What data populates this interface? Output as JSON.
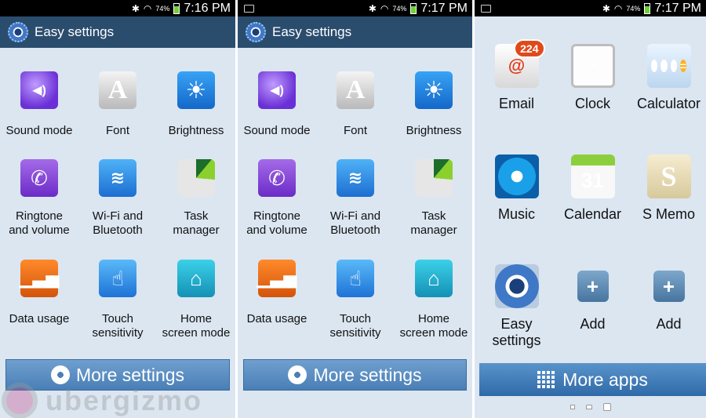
{
  "panel1": {
    "status": {
      "battery": "74%",
      "time": "7:16 PM"
    },
    "title": "Easy settings",
    "items": [
      {
        "label": "Sound mode",
        "icon": "sound-mode-icon"
      },
      {
        "label": "Font",
        "icon": "font-icon"
      },
      {
        "label": "Brightness",
        "icon": "brightness-icon"
      },
      {
        "label": "Ringtone\nand volume",
        "icon": "ringtone-icon"
      },
      {
        "label": "Wi-Fi and\nBluetooth",
        "icon": "wifi-bluetooth-icon"
      },
      {
        "label": "Task\nmanager",
        "icon": "task-manager-icon"
      },
      {
        "label": "Data usage",
        "icon": "data-usage-icon"
      },
      {
        "label": "Touch\nsensitivity",
        "icon": "touch-icon"
      },
      {
        "label": "Home\nscreen mode",
        "icon": "home-screen-icon"
      }
    ],
    "button": "More settings"
  },
  "panel2": {
    "status": {
      "battery": "74%",
      "time": "7:17 PM"
    },
    "title": "Easy settings",
    "items": [
      {
        "label": "Sound mode"
      },
      {
        "label": "Font"
      },
      {
        "label": "Brightness"
      },
      {
        "label": "Ringtone\nand volume"
      },
      {
        "label": "Wi-Fi and\nBluetooth"
      },
      {
        "label": "Task\nmanager"
      },
      {
        "label": "Data usage"
      },
      {
        "label": "Touch\nsensitivity"
      },
      {
        "label": "Home\nscreen mode"
      }
    ],
    "button": "More settings"
  },
  "panel3": {
    "status": {
      "battery": "74%",
      "time": "7:17 PM"
    },
    "apps": [
      {
        "label": "Email",
        "badge": "224"
      },
      {
        "label": "Clock"
      },
      {
        "label": "Calculator"
      },
      {
        "label": "Music"
      },
      {
        "label": "Calendar",
        "date": "31"
      },
      {
        "label": "S Memo"
      },
      {
        "label": "Easy\nsettings"
      },
      {
        "label": "Add"
      },
      {
        "label": "Add"
      }
    ],
    "button": "More apps"
  },
  "watermark": "ubergizmo",
  "colors": {
    "titlebar": "#2a4d6e",
    "background": "#dbe6f1",
    "button": "#4a7fb6"
  }
}
